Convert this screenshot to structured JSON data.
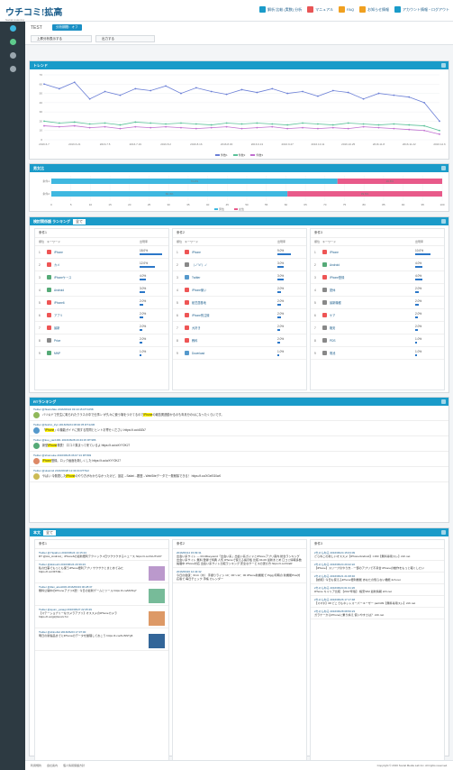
{
  "header": {
    "logo_main": "ウチコミ!拡高",
    "logo_sub": "Social Listening",
    "menu": [
      {
        "label": "解析 比較 (実数) 分析",
        "icon": "chart-icon",
        "color": "#1a9bc9"
      },
      {
        "label": "マニュアル",
        "icon": "book-icon",
        "color": "#e85555"
      },
      {
        "label": "FAQ",
        "icon": "question-icon",
        "color": "#f0a020"
      },
      {
        "label": "お知らせ情報",
        "icon": "bell-icon",
        "color": "#f0a020"
      },
      {
        "label": "アカウント情報・ログアウト",
        "icon": "user-icon",
        "color": "#1a9bc9"
      }
    ]
  },
  "sidebar": {
    "items": [
      {
        "icon": "dashboard-icon",
        "color": "#3fb8e0"
      },
      {
        "icon": "globe-icon",
        "color": "#5ecb8c"
      },
      {
        "icon": "tools-icon",
        "color": "#9aa6ae"
      },
      {
        "icon": "gear-icon",
        "color": "#9aa6ae"
      }
    ]
  },
  "project": {
    "title": "TEST",
    "badge": "分析期間：オフ",
    "btn_left": "上昇分析表示する",
    "btn_right": "出力する"
  },
  "trend": {
    "title": "トレンド",
    "legend": [
      "件数1",
      "件数2",
      "件数3"
    ],
    "chart_data": {
      "type": "line",
      "x": [
        "2016.6.7",
        "2016.6.14",
        "2016.6.21",
        "2016.6.28",
        "2016.7.5",
        "2016.7.12",
        "2016.7.19",
        "2016.7.26",
        "2016.8.2",
        "2016.8.9",
        "2016.8.16",
        "2016.8.23",
        "2016.8.30",
        "2016.9.6",
        "2016.9.13",
        "2016.9.20",
        "2016.9.27",
        "2016.10.4",
        "2016.10.11",
        "2016.10.18",
        "2016.10.25",
        "2016.11.1",
        "2016.11.8",
        "2016.11.15",
        "2016.11.22",
        "2016.11.29",
        "2016.12.6"
      ],
      "xticks": [
        "2016.6.7",
        "2016.6.21",
        "2016.7.5",
        "2016.7.19",
        "2016.8.2",
        "2016.8.16",
        "2016.8.30",
        "2016.9.13",
        "2016.9.27",
        "2016.10.11",
        "2016.10.25",
        "2016.11.8",
        "2016.11.22",
        "2016.12.6"
      ],
      "ylim": [
        0,
        70
      ],
      "yticks": [
        0,
        10,
        20,
        30,
        40,
        50,
        60,
        70
      ],
      "series": [
        {
          "name": "件数1",
          "color": "#6b7fd6",
          "values": [
            60,
            55,
            62,
            44,
            52,
            48,
            55,
            53,
            58,
            50,
            56,
            52,
            49,
            54,
            51,
            55,
            50,
            52,
            47,
            53,
            51,
            44,
            50,
            48,
            46,
            40,
            20
          ]
        },
        {
          "name": "件数2",
          "color": "#5cc29a",
          "values": [
            20,
            18,
            19,
            17,
            18,
            16,
            19,
            18,
            17,
            18,
            17,
            16,
            18,
            17,
            18,
            17,
            16,
            18,
            17,
            16,
            18,
            17,
            16,
            17,
            16,
            15,
            10
          ]
        },
        {
          "name": "件数3",
          "color": "#c06fd0",
          "values": [
            15,
            14,
            15,
            13,
            14,
            12,
            14,
            13,
            14,
            13,
            12,
            13,
            14,
            12,
            13,
            14,
            12,
            13,
            12,
            13,
            12,
            14,
            13,
            12,
            11,
            10,
            6
          ]
        }
      ]
    }
  },
  "gender": {
    "title": "男女比",
    "legend": [
      "男性",
      "女性"
    ],
    "chart_data": {
      "type": "bar",
      "orientation": "horizontal",
      "categories": [
        "条件1",
        "条件2"
      ],
      "xlim": [
        0,
        100
      ],
      "xticks": [
        0,
        5,
        10,
        15,
        20,
        25,
        30,
        35,
        40,
        45,
        50,
        55,
        60,
        65,
        70,
        75,
        80,
        85,
        90,
        95,
        100
      ],
      "series": [
        {
          "name": "男性",
          "color": "#3fb8e0",
          "values": [
            73.2,
            60.4
          ]
        },
        {
          "name": "女性",
          "color": "#e85a8a",
          "values": [
            26.8,
            39.6
          ]
        }
      ]
    }
  },
  "ranking": {
    "title": "検討関係語 ランキング",
    "select": "全て",
    "header": {
      "rank": "順位",
      "kw": "キーワード",
      "pct": "出現率"
    },
    "columns": [
      {
        "name": "条件1",
        "rows": [
          {
            "kw": "iPhone",
            "pct": "18.0%",
            "bar": 0.9,
            "color": "#e55"
          },
          {
            "kw": "カメ",
            "pct": "12.0%",
            "bar": 0.6,
            "color": "#e55"
          },
          {
            "kw": "iPhoneケース",
            "pct": "4.0%",
            "bar": 0.25,
            "color": "#5a7"
          },
          {
            "kw": "Android",
            "pct": "3.0%",
            "bar": 0.2,
            "color": "#5a7"
          },
          {
            "kw": "iPhone6",
            "pct": "2.0%",
            "bar": 0.15,
            "color": "#e55"
          },
          {
            "kw": "アプリ",
            "pct": "2.0%",
            "bar": 0.15,
            "color": "#e55"
          },
          {
            "kw": "最新",
            "pct": "2.0%",
            "bar": 0.12,
            "color": "#e55"
          },
          {
            "kw": "Price",
            "pct": "2.0%",
            "bar": 0.12,
            "color": "#888"
          },
          {
            "kw": "MNP",
            "pct": "1.0%",
            "bar": 0.08,
            "color": "#5a7"
          }
        ]
      },
      {
        "name": "条件2",
        "rows": [
          {
            "kw": "iPhone",
            "pct": "9.0%",
            "bar": 0.55,
            "color": "#e55"
          },
          {
            "kw": "（ノ°ο°）ノ",
            "pct": "3.0%",
            "bar": 0.25,
            "color": "#888"
          },
          {
            "kw": "Twitter",
            "pct": "3.0%",
            "bar": 0.25,
            "color": "#59c"
          },
          {
            "kw": "iPhone使い",
            "pct": "2.0%",
            "bar": 0.15,
            "color": "#e55"
          },
          {
            "kw": "紙芝居基地",
            "pct": "2.0%",
            "bar": 0.15,
            "color": "#e55"
          },
          {
            "kw": "iPhone別注録",
            "pct": "2.0%",
            "bar": 0.15,
            "color": "#e55"
          },
          {
            "kw": "大好き",
            "pct": "2.0%",
            "bar": 0.12,
            "color": "#e55"
          },
          {
            "kw": "教科",
            "pct": "2.0%",
            "bar": 0.12,
            "color": "#e55"
          },
          {
            "kw": "Download",
            "pct": "1.0%",
            "bar": 0.08,
            "color": "#59c"
          }
        ]
      },
      {
        "name": "条件3",
        "rows": [
          {
            "kw": "iPhone",
            "pct": "10.0%",
            "bar": 0.6,
            "color": "#e55"
          },
          {
            "kw": "Android",
            "pct": "4.0%",
            "bar": 0.3,
            "color": "#5a7"
          },
          {
            "kw": "iPhone登録",
            "pct": "4.0%",
            "bar": 0.3,
            "color": "#e55"
          },
          {
            "kw": "夏休",
            "pct": "2.0%",
            "bar": 0.15,
            "color": "#888"
          },
          {
            "kw": "最新機種",
            "pct": "2.0%",
            "bar": 0.15,
            "color": "#888"
          },
          {
            "kw": "ケア",
            "pct": "2.0%",
            "bar": 0.12,
            "color": "#e55"
          },
          {
            "kw": "格安",
            "pct": "2.0%",
            "bar": 0.12,
            "color": "#888"
          },
          {
            "kw": "PDS",
            "pct": "1.0%",
            "bar": 0.08,
            "color": "#888"
          },
          {
            "kw": "電池",
            "pct": "1.0%",
            "bar": 0.08,
            "color": "#888"
          }
        ]
      }
    ]
  },
  "rt": {
    "title": "RTランキング",
    "rows": [
      {
        "meta": "Twitter @hkazuhiko 2016/06/24 03:10:15 RT:1058",
        "pre": "バリ公ドで先生に取られたクラスの中で仕事ン が久々に使う場をつけてるので",
        "hl": "iPhone",
        "post": "の報告関連動かるのも年月分の公になったくらいです。",
        "avatar": "#8fb85a"
      },
      {
        "meta": "Twitter @brahm_Zyn 2016/06/24 08:46:35 RT:1236",
        "pre": "「",
        "hl": "iPhone",
        "post": "」の機能ガイドに関する質問とヒントお寄せください https://t.co/d0Zk7",
        "avatar": "#59c"
      },
      {
        "meta": "Twitter @kuu_yan1001 2016/06/28 20:43:15 RT:986",
        "pre": "新型",
        "hl": "iPhone",
        "post": "発表！ 口コミ集まって来ているよ https://t.co/wXYY2KJ7",
        "avatar": "#5a7"
      },
      {
        "meta": "Twitter @shunsuke 2016/06/26 06:07:13 RT:803",
        "pre": "",
        "hl": "iPhone",
        "post": "登録。ロック画面を新しくした https://t.co/wXYY2KJ7",
        "avatar": "#d86"
      },
      {
        "meta": "Twitter @ukunin2 2016/06/28 12:34:04 RT:512",
        "pre": "やばい 今発表した",
        "hl": "iPhone",
        "post": "のやり方がわからなかったけど、設定→Safari→履歴→WebSiteデータで一発削除できる！ https://t.co/XGeEG0w0",
        "avatar": "#cb5"
      }
    ]
  },
  "news": {
    "title": "本文",
    "select": "全て",
    "columns": [
      {
        "name": "条件1",
        "items": [
          {
            "meta": "Twitter @Ykpahun 2016/06/24 14:15:24",
            "text": "RT @Asi_Android_: iPhone6の最新便利テクニック 2日ワクワクするニュース https://t.co/XsUTLI07",
            "thumb": ""
          },
          {
            "meta": "Twitter @kkinoshi 2016/06/24 20:39:23",
            "text": "私の仕事でもっとも使うiPhone便利アプリ サクサクとまとめてみた https://t.co/3FTdE…",
            "thumb": "#b9c"
          },
          {
            "meta": "Twitter @Zan_aku1003 2016/06/23 06:28:37",
            "text": "無料公開中のiPhoneアプリ6選！今日の最新ゲームとツール https://t.co/M2fzq7",
            "thumb": "#7b9"
          },
          {
            "meta": "Twitter @ayum_yanagi 2016/06/27 22:45:29",
            "text": "【ステーショナリーなカメラアプリ】オススメのiPhoneカメラ https://t.co/jpQGnvrL7nr",
            "thumb": "#d96"
          },
          {
            "meta": "Twitter @shinobid 2016/06/23 17:37:00",
            "text": "明日の新製品までにiPhoneのデータを整理しておこう https://t.co/AUNSTg5",
            "thumb": "#369"
          }
        ]
      },
      {
        "name": "条件2",
        "items": [
          {
            "meta": "2016/06/14 15:09:31",
            "text": "出会い系サイト — 03-04keyword「出会い系」出会い系ガイドとiPhoneアプリ案内 総合ランキング 出会い系サイト 無料 登録で特典 人気 iPhoneで使える掲示板 比較 04-06 最新まとめ 口コミ情報多数掲載中 iPhone対応 出会い系サイト比較ランキング 安全なサービスの選び方 https://t.co/XzaR",
            "thumb": ""
          },
          {
            "meta": "2016/06/26 12:43:32",
            "text": "今日の健康：6/14（木） 手振りライン 10：00〜12：00 iPhone新機能で Piggy何時の 新機能Plus対応版で 毎日チェック 手帳 カレンダー",
            "thumb": ""
          }
        ]
      },
      {
        "name": "条件3",
        "items": [
          {
            "meta": "2ちゃんねる 2016/06/24 15:03:09",
            "text": "どらねこの新しいオススメ【iPhone/Android】×160【無料専用スレ】2ch.net",
            "thumb": ""
          },
          {
            "meta": "2ちゃんねる 2016/06/24 20:22:22",
            "text": "【iPhone】スリープのやり方…一部のアプリで不具合 iPhoneの動作をもっと軽くしたい",
            "thumb": ""
          },
          {
            "meta": "2ちゃんねる 2016/06/21 21:08:46",
            "text": "【試用】今日も使えるiPhone便利機能 あなたの知らない機能 2ch.net",
            "thumb": ""
          },
          {
            "meta": "2ちゃんねる 2016/06/24 01:31:26",
            "text": "iPhone キャリア比較 【2017年版】 格安SIM 最新情報 2ch.net",
            "thumb": ""
          },
          {
            "meta": "2ちゃんねる 2016/06/26 17:17:48",
            "text": "【スマホ】08 どこでもネットスーパーユーザー part109【無料専用スレ】2ch.net",
            "thumb": ""
          },
          {
            "meta": "2ちゃんねる 2016/06/28 08:50:23",
            "text": "ガラケーからiPhoneに乗り換え 使いやすさは？ 2ch.net",
            "thumb": ""
          }
        ]
      }
    ]
  },
  "footer": {
    "links": [
      "利用規約",
      "会社案内",
      "個人情報保護方針"
    ],
    "copyright": "Copyright © 2016 Social Media Lab Inc. All rights reserved."
  }
}
